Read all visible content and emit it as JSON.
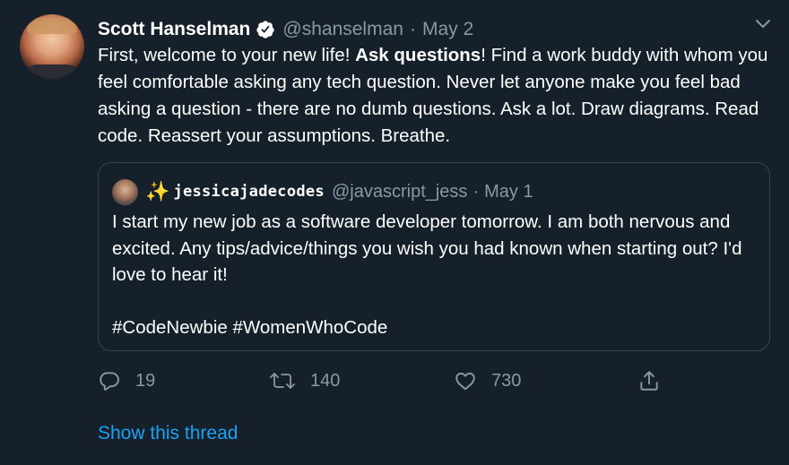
{
  "tweet": {
    "display_name": "Scott Hanselman",
    "handle": "@shanselman",
    "separator": "·",
    "date": "May 2",
    "text_before_bold": "First, welcome to your new life! ",
    "text_bold": "Ask questions",
    "text_after_bold": "! Find a work buddy with whom you feel comfortable asking any tech question. Never let anyone make you feel bad asking a question - there are no dumb questions. Ask a lot. Draw diagrams. Read code. Reassert your assumptions. Breathe.",
    "verified_icon": "verified-badge-icon",
    "more_icon": "chevron-down-icon"
  },
  "quote": {
    "emoji": "✨",
    "display_name": "jessicajadecodes",
    "handle": "@javascript_jess",
    "separator": "·",
    "date": "May 1",
    "text": "I start my new job as a software developer tomorrow. I am both nervous and excited. Any tips/advice/things you wish you had known when starting out? I'd love to hear it!\n\n#CodeNewbie #WomenWhoCode"
  },
  "actions": {
    "reply_count": "19",
    "retweet_count": "140",
    "like_count": "730"
  },
  "show_thread_label": "Show this thread",
  "colors": {
    "background": "#15202b",
    "secondary_text": "#8899a6",
    "link": "#1da1f2",
    "border": "#38444d"
  }
}
